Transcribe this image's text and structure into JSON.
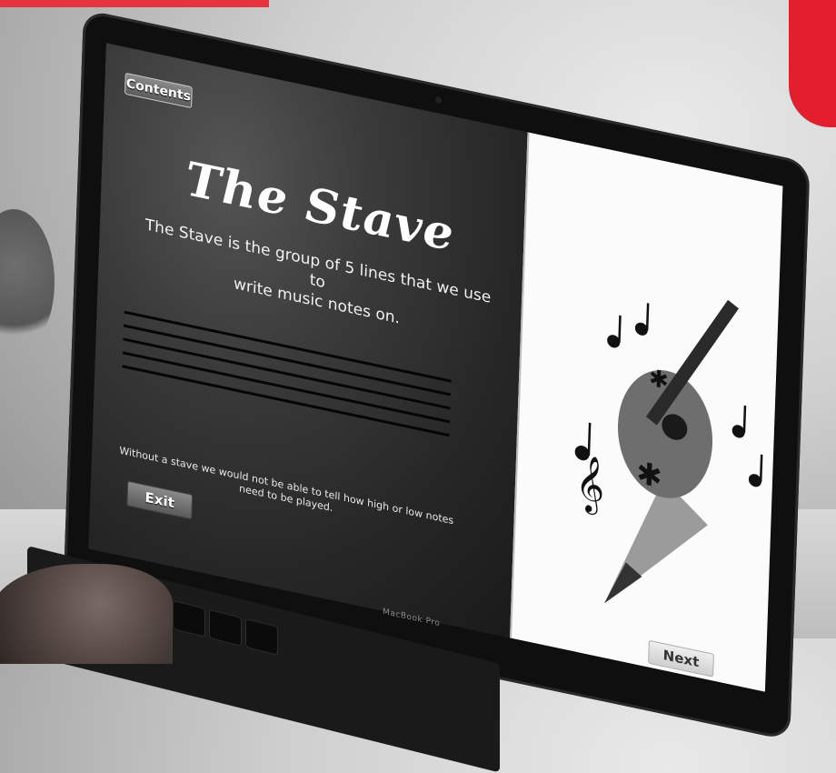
{
  "screen": {
    "contents_label": "Contents",
    "title": "The Stave",
    "subtitle_line1": "The Stave is the group of 5 lines that we use to",
    "subtitle_line2": "write music notes on.",
    "staff_line_count": 5,
    "footnote_line1": "Without a stave we would not be able to tell how high or low notes",
    "footnote_line2": "need to be played.",
    "exit_label": "Exit",
    "next_label": "Next"
  },
  "device": {
    "brand": "MacBook Pro"
  },
  "colors": {
    "accent_red": "#e31e2d"
  },
  "icons": {
    "illustration": "guitar-music-notes-illustration"
  }
}
